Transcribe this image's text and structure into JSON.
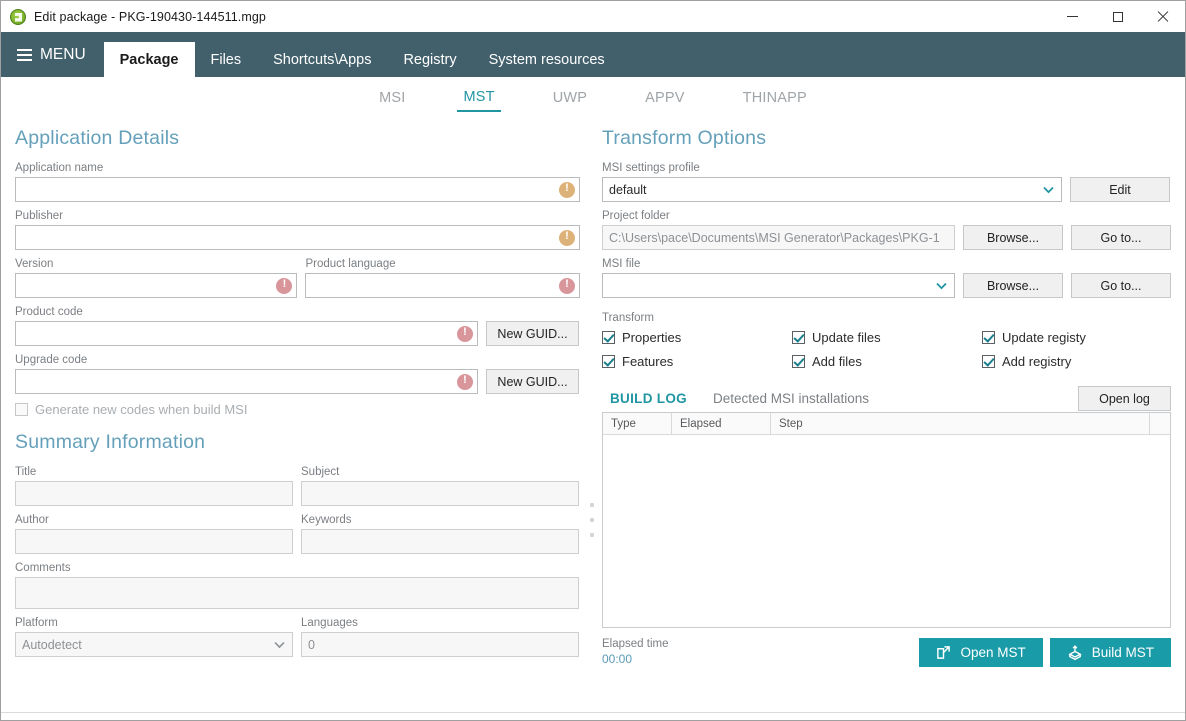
{
  "window": {
    "title": "Edit package - PKG-190430-144511.mgp",
    "icon": "app-logo-icon",
    "minimize": "–",
    "maximize": "□",
    "close": "×"
  },
  "nav": {
    "menu_label": "MENU",
    "tabs": [
      {
        "label": "Package",
        "active": true
      },
      {
        "label": "Files",
        "active": false
      },
      {
        "label": "Shortcuts\\Apps",
        "active": false
      },
      {
        "label": "Registry",
        "active": false
      },
      {
        "label": "System resources",
        "active": false
      }
    ]
  },
  "subtabs": [
    {
      "label": "MSI",
      "active": false
    },
    {
      "label": "MST",
      "active": true
    },
    {
      "label": "UWP",
      "active": false
    },
    {
      "label": "APPV",
      "active": false
    },
    {
      "label": "THINAPP",
      "active": false
    }
  ],
  "application_details": {
    "heading": "Application Details",
    "application_name": {
      "label": "Application name",
      "value": "",
      "badge": "!"
    },
    "publisher": {
      "label": "Publisher",
      "value": "",
      "badge": "!"
    },
    "version": {
      "label": "Version",
      "value": "",
      "badge": "!"
    },
    "product_language": {
      "label": "Product language",
      "value": "",
      "badge": "!"
    },
    "product_code": {
      "label": "Product code",
      "value": "",
      "badge": "!",
      "button": "New GUID..."
    },
    "upgrade_code": {
      "label": "Upgrade code",
      "value": "",
      "badge": "!",
      "button": "New GUID..."
    },
    "generate_new_codes": {
      "label": "Generate new codes when build MSI",
      "checked": false
    }
  },
  "summary_information": {
    "heading": "Summary Information",
    "title": {
      "label": "Title",
      "value": ""
    },
    "subject": {
      "label": "Subject",
      "value": ""
    },
    "author": {
      "label": "Author",
      "value": ""
    },
    "keywords": {
      "label": "Keywords",
      "value": ""
    },
    "comments": {
      "label": "Comments",
      "value": ""
    },
    "platform": {
      "label": "Platform",
      "value": "Autodetect"
    },
    "languages": {
      "label": "Languages",
      "value": "0"
    }
  },
  "transform_options": {
    "heading": "Transform Options",
    "msi_settings_profile": {
      "label": "MSI settings profile",
      "value": "default",
      "button": "Edit"
    },
    "project_folder": {
      "label": "Project folder",
      "value": "C:\\Users\\pace\\Documents\\MSI Generator\\Packages\\PKG-1",
      "browse": "Browse...",
      "goto": "Go to..."
    },
    "msi_file": {
      "label": "MSI file",
      "value": "",
      "browse": "Browse...",
      "goto": "Go to..."
    },
    "transform_label": "Transform",
    "checks": [
      {
        "label": "Properties",
        "checked": true
      },
      {
        "label": "Update files",
        "checked": true
      },
      {
        "label": "Update registy",
        "checked": true
      },
      {
        "label": "Features",
        "checked": true
      },
      {
        "label": "Add files",
        "checked": true
      },
      {
        "label": "Add registry",
        "checked": true
      }
    ]
  },
  "build_log": {
    "tabs": [
      {
        "label": "BUILD LOG",
        "active": true
      },
      {
        "label": "Detected MSI installations",
        "active": false
      }
    ],
    "open_log_button": "Open log",
    "columns": [
      "Type",
      "Elapsed",
      "Step",
      ""
    ],
    "rows": []
  },
  "footer": {
    "elapsed_label": "Elapsed time",
    "elapsed_value": "00:00",
    "open_mst": "Open MST",
    "build_mst": "Build MST"
  },
  "colors": {
    "navbar": "#42606c",
    "accent_teal": "#2196a3",
    "heading_blue": "#65a0bb",
    "warn": "#ddb278",
    "error": "#d8969b",
    "primary_button": "#1a9ba8"
  }
}
